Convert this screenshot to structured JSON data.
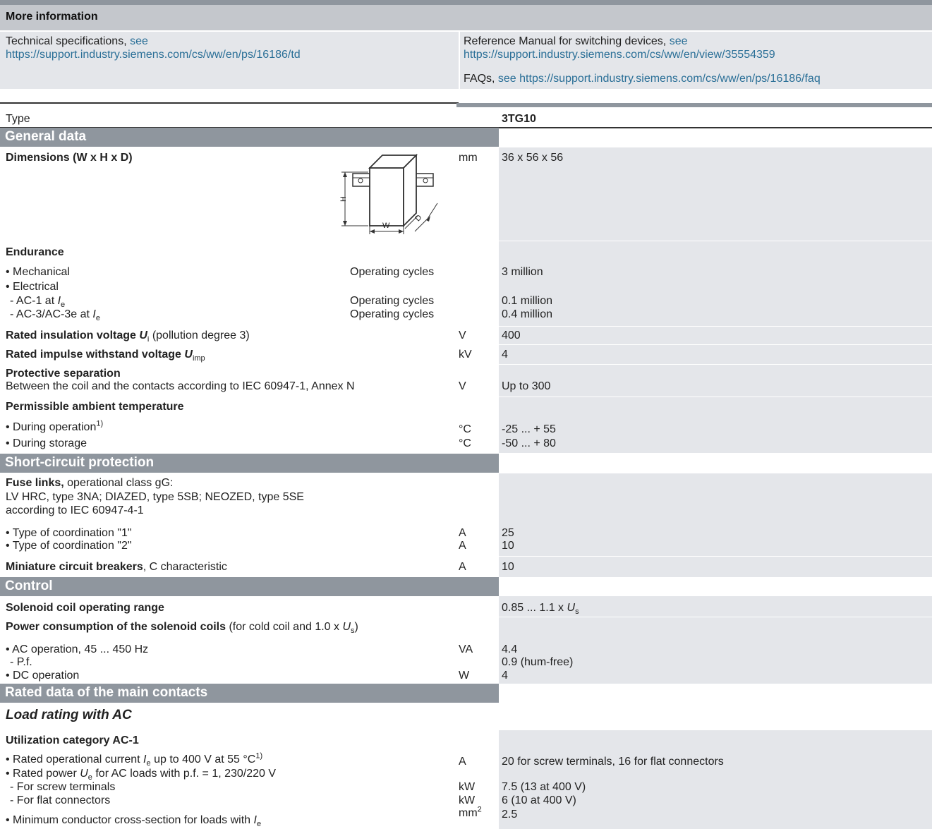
{
  "more_info": {
    "title": "More information",
    "left_text": "Technical specifications, ",
    "left_see": "see",
    "left_url": "https://support.industry.siemens.com/cs/ww/en/ps/16186/td",
    "right_text": "Reference Manual for switching devices, ",
    "right_see": "see",
    "right_url": "https://support.industry.siemens.com/cs/ww/en/view/35554359",
    "faq_text": "FAQs, ",
    "faq_link": "see https://support.industry.siemens.com/cs/ww/en/ps/16186/faq"
  },
  "table": {
    "type_label": "Type",
    "type_value": "3TG10",
    "sections": {
      "general": "General data",
      "short_circuit": "Short-circuit protection",
      "control": "Control",
      "rated": "Rated data of the main contacts"
    },
    "dimensions": {
      "label": "Dimensions (W x H x D)",
      "unit": "mm",
      "value": "36 x 56 x 56",
      "fig_h": "H",
      "fig_w": "W",
      "fig_d": "D"
    },
    "endurance": {
      "label": "Endurance",
      "mech": "• Mechanical",
      "mech_unit": "Operating cycles",
      "mech_val": "3 million",
      "elec": "• Electrical",
      "ac1_pre": "- AC-1 at ",
      "ac1_unit": "Operating cycles",
      "ac1_val": "0.1 million",
      "ac3_pre": "- AC-3/AC-3e at ",
      "ac3_unit": "Operating cycles",
      "ac3_val": "0.4 million"
    },
    "insulation": {
      "label": "Rated insulation voltage ",
      "sym": "U",
      "sub": "i",
      "rest": " (pollution degree 3)",
      "unit": "V",
      "value": "400"
    },
    "impulse": {
      "label": "Rated impulse withstand voltage ",
      "sym": "U",
      "sub": "imp",
      "unit": "kV",
      "value": "4"
    },
    "separation": {
      "label": "Protective separation",
      "desc": "Between the coil and the contacts according to IEC 60947-1, Annex N",
      "unit": "V",
      "value": "Up to 300"
    },
    "ambient": {
      "label": "Permissible ambient temperature",
      "op": "• During operation",
      "op_sup": "1)",
      "op_unit": "°C",
      "op_val": "-25 ... + 55",
      "st": "• During storage",
      "st_unit": "°C",
      "st_val": "-50 ... + 80"
    },
    "fuse": {
      "label": "Fuse links,",
      "label_rest": " operational class gG:",
      "line2": "LV HRC, type 3NA; DIAZED, type 5SB; NEOZED, type 5SE",
      "line3": "according to IEC 60947-4-1",
      "c1": "• Type of coordination \"1\"",
      "c1_unit": "A",
      "c1_val": "25",
      "c2": "• Type of coordination \"2\"",
      "c2_unit": "A",
      "c2_val": "10"
    },
    "mcb": {
      "label": "Miniature circuit breakers",
      "rest": ", C characteristic",
      "unit": "A",
      "value": "10"
    },
    "solenoid_range": {
      "label": "Solenoid coil operating range",
      "value_pre": "0.85 ... 1.1 x ",
      "value_sym": "U",
      "value_sub": "s"
    },
    "power": {
      "label": "Power consumption of the solenoid coils",
      "rest_pre": " (for cold coil and 1.0 x ",
      "rest_sym": "U",
      "rest_sub": "s",
      "rest_post": ")",
      "ac": "• AC operation, 45 ... 450 Hz",
      "ac_unit": "VA",
      "ac_val": "4.4",
      "pf": "- P.f.",
      "pf_val": "0.9 (hum-free)",
      "dc": "• DC operation",
      "dc_unit": "W",
      "dc_val": "4"
    },
    "load_ac": "Load rating with AC",
    "ac1": {
      "label": "Utilization category AC-1",
      "cur_pre": "• Rated operational current ",
      "cur_post": " up to 400 V at 55 °C",
      "cur_sup": "1)",
      "cur_unit": "A",
      "cur_val": "20 for screw terminals, 16 for flat connectors",
      "pow_pre": "• Rated power ",
      "pow_post": " for AC loads with p.f. = 1, 230/220 V",
      "screw": "- For screw terminals",
      "screw_unit": "kW",
      "screw_val": "7.5 (13 at 400 V)",
      "flat": "- For flat connectors",
      "flat_unit": "kW",
      "flat_val": "6 (10 at 400 V)",
      "min": "• Minimum conductor cross-section for loads with ",
      "min_unit": "mm",
      "min_unit_sup": "2",
      "min_val": "2.5"
    }
  }
}
